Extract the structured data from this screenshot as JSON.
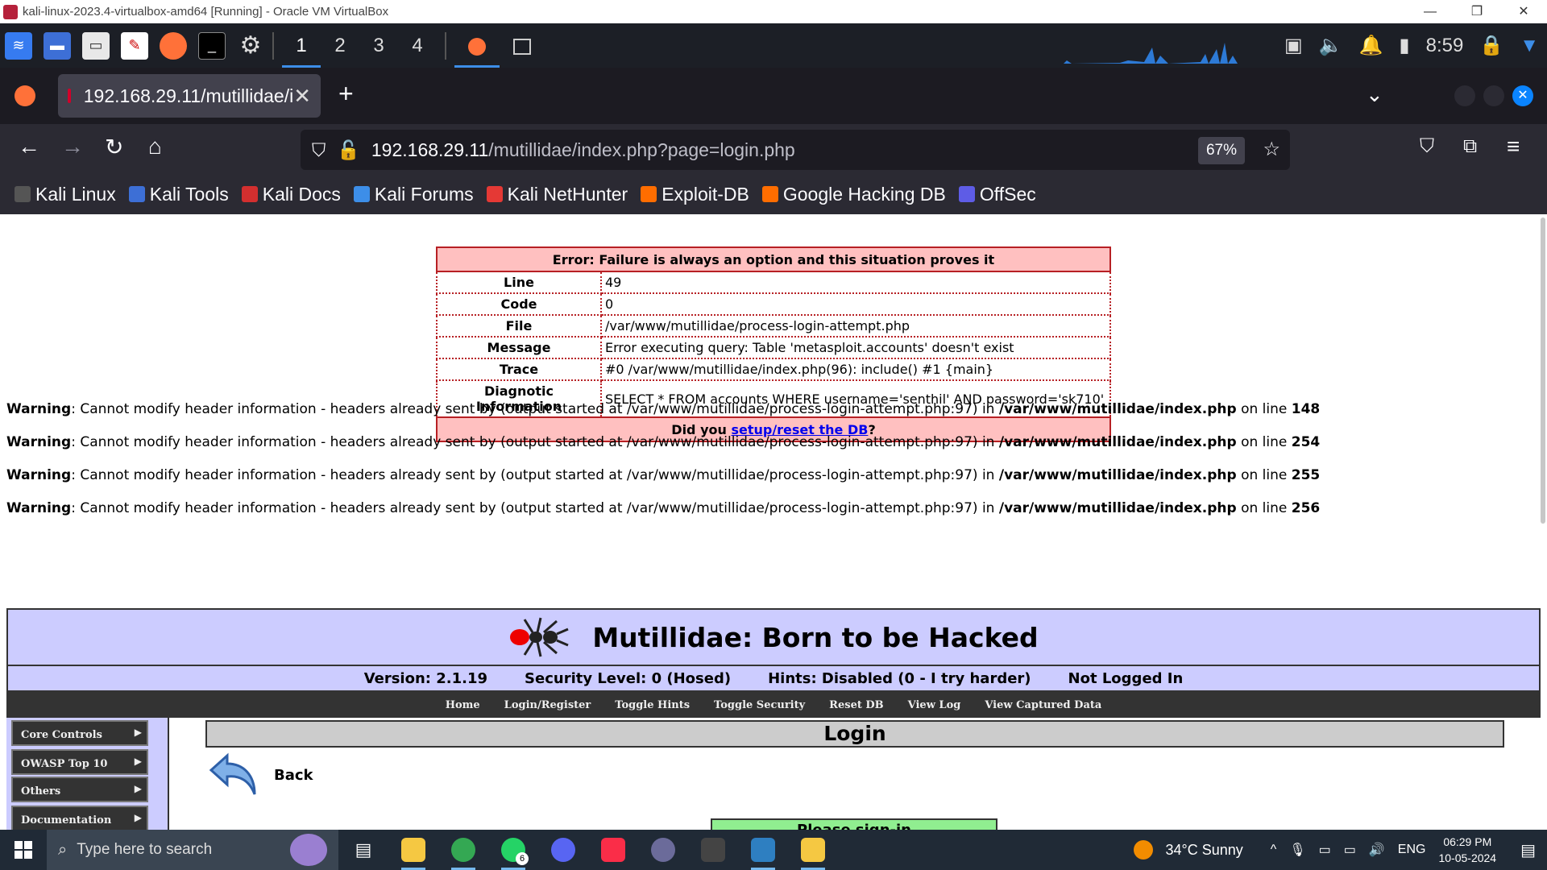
{
  "vbox": {
    "title": "kali-linux-2023.4-virtualbox-amd64 [Running] - Oracle VM VirtualBox",
    "minimize": "—",
    "restore": "❐",
    "close": "✕"
  },
  "kali_panel": {
    "workspaces": [
      "1",
      "2",
      "3",
      "4"
    ],
    "time": "8:59"
  },
  "firefox": {
    "tab_title": "192.168.29.11/mutillidae/i",
    "url_domain": "192.168.29.11",
    "url_path": "/mutillidae/index.php?page=login.php",
    "zoom": "67%",
    "bookmarks": [
      "Kali Linux",
      "Kali Tools",
      "Kali Docs",
      "Kali Forums",
      "Kali NetHunter",
      "Exploit-DB",
      "Google Hacking DB",
      "OffSec"
    ]
  },
  "error": {
    "heading": "Error: Failure is always an option and this situation proves it",
    "rows": [
      {
        "label": "Line",
        "value": "49"
      },
      {
        "label": "Code",
        "value": "0"
      },
      {
        "label": "File",
        "value": "/var/www/mutillidae/process-login-attempt.php"
      },
      {
        "label": "Message",
        "value": "Error executing query: Table 'metasploit.accounts' doesn't exist"
      },
      {
        "label": "Trace",
        "value": "#0 /var/www/mutillidae/index.php(96): include() #1 {main}"
      },
      {
        "label": "Diagnotic Information",
        "value": "SELECT * FROM accounts WHERE username='senthil' AND password='sk710'"
      }
    ],
    "footer_prefix": "Did you ",
    "footer_link": "setup/reset the DB",
    "footer_suffix": "?"
  },
  "warnings": {
    "label": "Warning",
    "text": ": Cannot modify header information - headers already sent by (output started at /var/www/mutillidae/process-login-attempt.php:97) in ",
    "file": "/var/www/mutillidae/index.php",
    "on_line": " on line ",
    "lines": [
      "148",
      "254",
      "255",
      "256"
    ]
  },
  "mutillidae": {
    "title": "Mutillidae: Born to be Hacked",
    "version": "Version: 2.1.19",
    "security": "Security Level: 0 (Hosed)",
    "hints": "Hints: Disabled (0 - I try harder)",
    "login_status": "Not Logged In",
    "menu": [
      "Home",
      "Login/Register",
      "Toggle Hints",
      "Toggle Security",
      "Reset DB",
      "View Log",
      "View Captured Data"
    ],
    "side_menu": [
      "Core Controls",
      "OWASP Top 10",
      "Others",
      "Documentation"
    ],
    "page_title": "Login",
    "back_label": "Back",
    "signin_label": "Please sign-in"
  },
  "windows": {
    "search_placeholder": "Type here to search",
    "weather": "34°C  Sunny",
    "lang": "ENG",
    "time": "06:29 PM",
    "date": "10-05-2024",
    "whatsapp_badge": "6"
  }
}
